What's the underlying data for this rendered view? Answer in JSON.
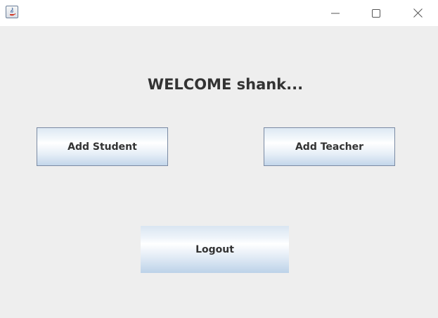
{
  "window": {
    "title": "",
    "controls": {
      "minimize_icon": "minimize-icon",
      "maximize_icon": "maximize-icon",
      "close_icon": "close-icon"
    },
    "app_icon": "java-app-icon"
  },
  "main": {
    "welcome_text": "WELCOME shank...",
    "buttons": {
      "add_student": "Add Student",
      "add_teacher": "Add Teacher",
      "logout": "Logout"
    }
  },
  "colors": {
    "background": "#eeeeee",
    "titlebar": "#ffffff",
    "text": "#333333",
    "button_border": "#7a8aa3",
    "button_gradient_bottom": "#c3d6ea"
  }
}
